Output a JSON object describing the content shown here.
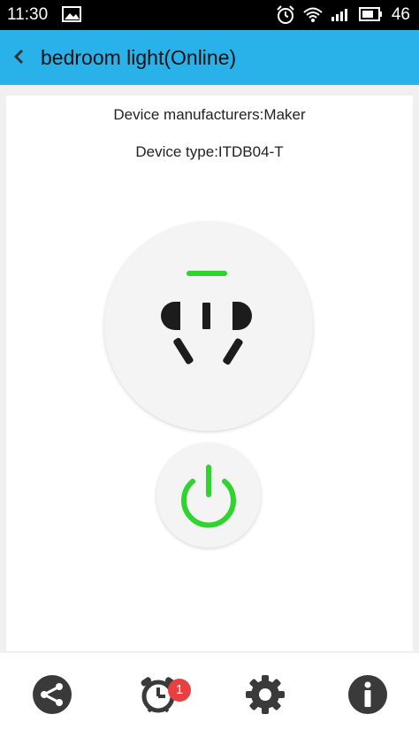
{
  "status_bar": {
    "time": "11:30",
    "signal_text": "46",
    "icons": [
      "image-icon",
      "alarm-icon",
      "wifi-icon",
      "signal-icon",
      "battery-icon"
    ]
  },
  "app_bar": {
    "back_icon": "chevron-left-icon",
    "title": "bedroom light(Online)",
    "color": "#29b1ea"
  },
  "device_info": {
    "manufacturer": "Device manufacturers:Maker",
    "type": "Device type:ITDB04-T"
  },
  "socket": {
    "indicator_color": "#2fd42f",
    "state": "on"
  },
  "power_button": {
    "icon": "power-icon",
    "color": "#2fd42f"
  },
  "bottom_nav": {
    "items": [
      {
        "icon": "share-icon"
      },
      {
        "icon": "timer-icon",
        "badge": "1"
      },
      {
        "icon": "settings-icon"
      },
      {
        "icon": "info-icon"
      }
    ],
    "badge_color": "#e84040"
  }
}
